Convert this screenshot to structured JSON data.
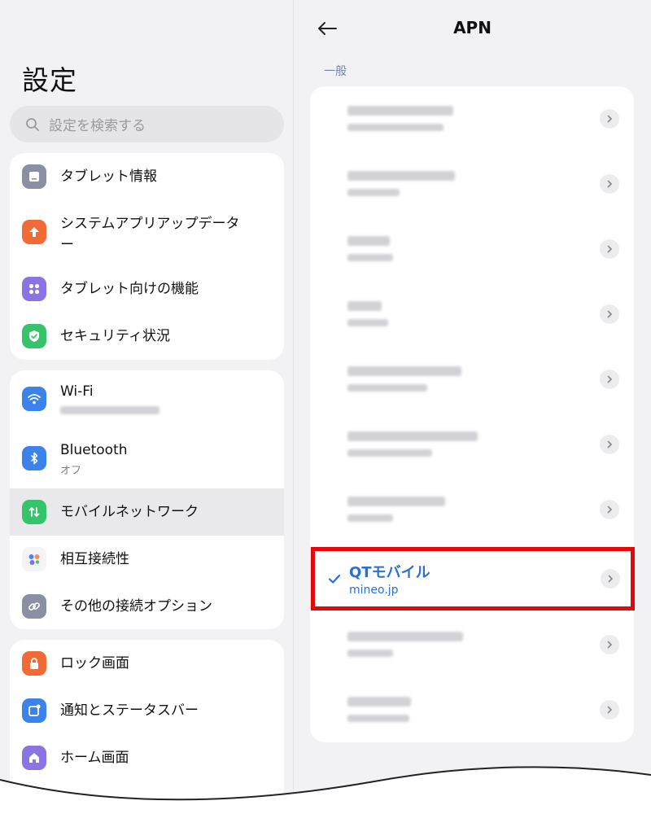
{
  "left": {
    "title": "設定",
    "search_placeholder": "設定を検索する",
    "group1": [
      {
        "label": "タブレット情報",
        "icon": "tablet-icon",
        "color": "#8a8fa3"
      },
      {
        "label_line1": "システムアプリアップデータ",
        "label_line2": "ー",
        "icon": "arrow-up-icon",
        "color": "#f26a35"
      },
      {
        "label": "タブレット向けの機能",
        "icon": "grid-icon",
        "color": "#8b73e3"
      },
      {
        "label": "セキュリティ状況",
        "icon": "shield-check-icon",
        "color": "#35c46b"
      }
    ],
    "group2": [
      {
        "label": "Wi-Fi",
        "icon": "wifi-icon",
        "color": "#3b82ea"
      },
      {
        "label": "Bluetooth",
        "sub": "オフ",
        "icon": "bluetooth-icon",
        "color": "#3b82ea"
      },
      {
        "label": "モバイルネットワーク",
        "icon": "mobile-data-icon",
        "color": "#35c46b"
      },
      {
        "label": "相互接続性",
        "icon": "interconnect-icon",
        "color": "#ffffff"
      },
      {
        "label": "その他の接続オプション",
        "icon": "link-icon",
        "color": "#8a8fa3"
      }
    ],
    "group3": [
      {
        "label": "ロック画面",
        "icon": "lock-icon",
        "color": "#f26a35"
      },
      {
        "label": "通知とステータスバー",
        "icon": "notification-icon",
        "color": "#3b82ea"
      },
      {
        "label": "ホーム画面",
        "icon": "home-icon",
        "color": "#8b73e3"
      }
    ]
  },
  "right": {
    "title": "APN",
    "section_label": "一般",
    "selected": {
      "name": "QTモバイル",
      "apn": "mineo.jp"
    }
  },
  "colors": {
    "highlight_border": "#e3090b",
    "selected_text": "#2a6fd6",
    "section_label": "#6f84b5"
  }
}
